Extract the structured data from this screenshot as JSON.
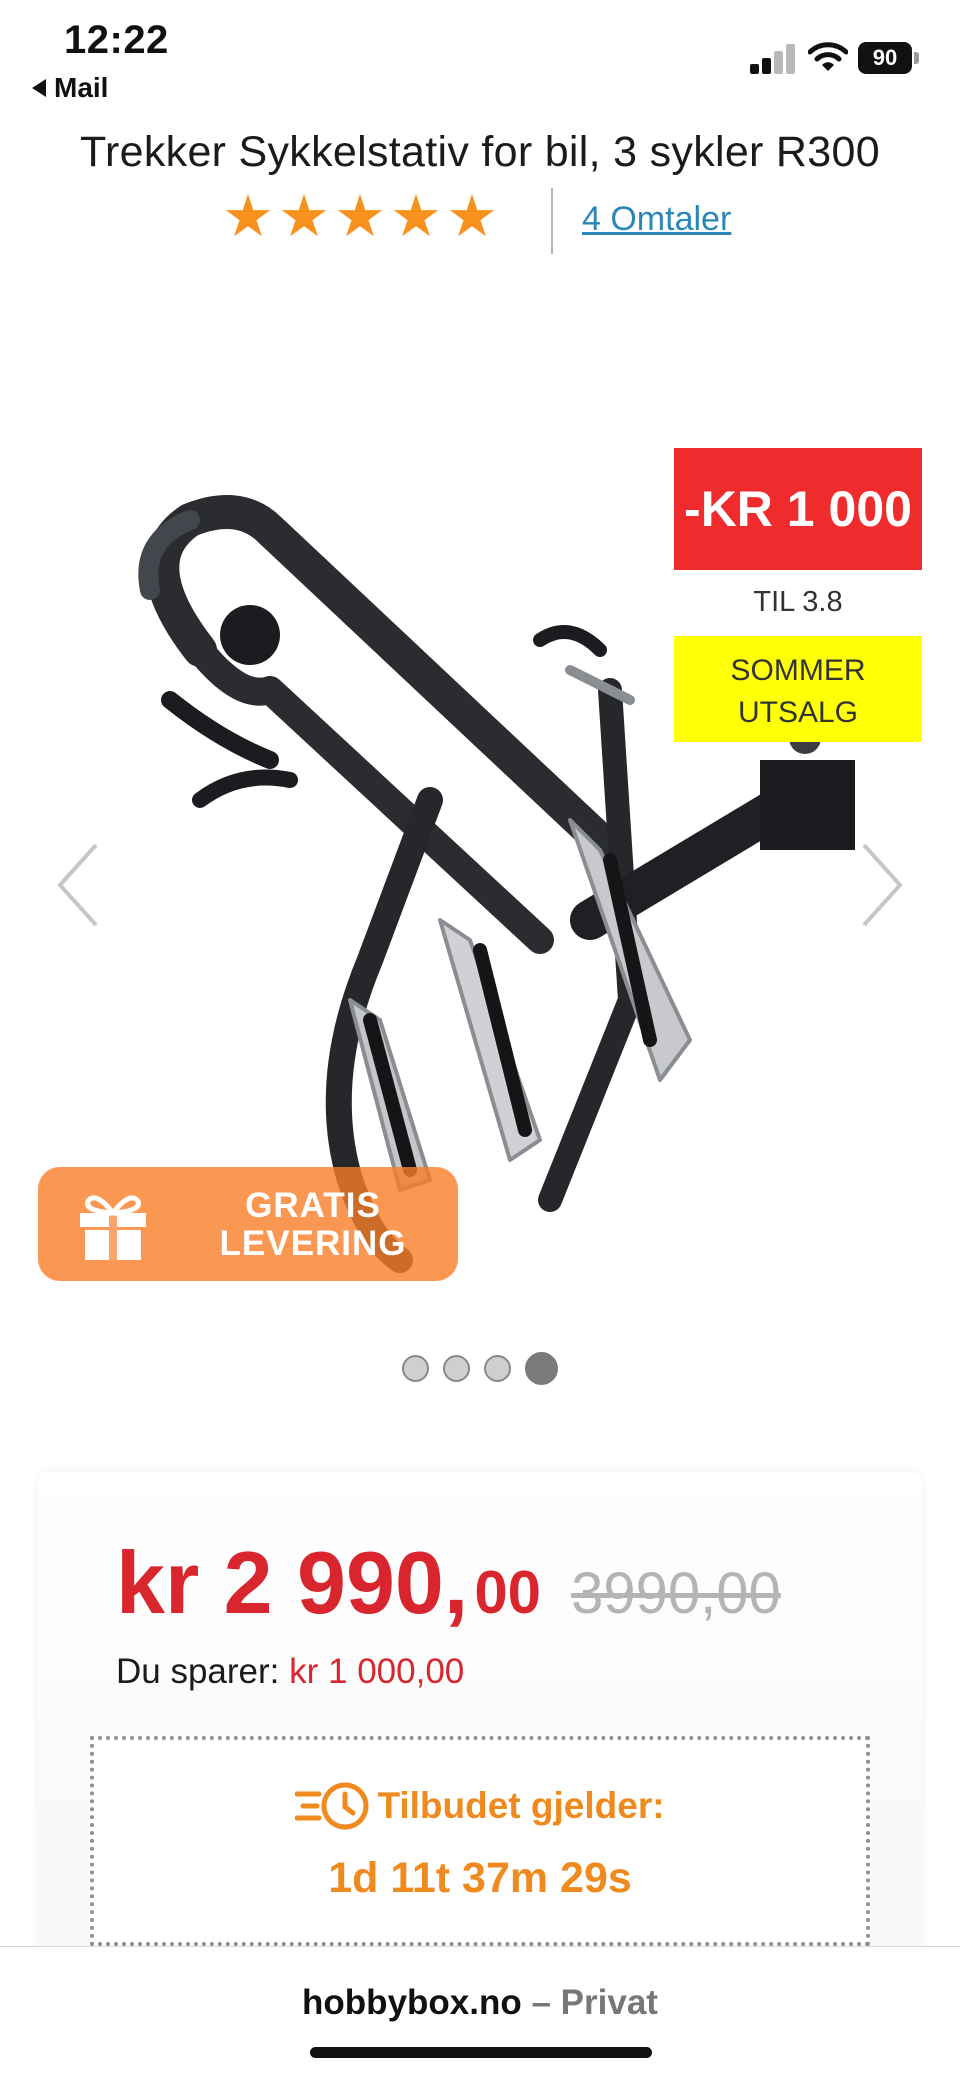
{
  "status_bar": {
    "time": "12:22",
    "back_app": "Mail",
    "battery": "90",
    "icons": [
      "signal-icon",
      "wifi-icon",
      "battery-icon"
    ]
  },
  "product": {
    "title": "Trekker Sykkelstativ for bil, 3 sykler R300",
    "rating_stars": 5,
    "reviews_link": "4 Omtaler"
  },
  "gallery": {
    "discount_badge": "-KR 1 000",
    "valid_until": "TIL 3.8",
    "sale_badge_line1": "SOMMER",
    "sale_badge_line2": "UTSALG",
    "free_delivery_line1": "GRATIS",
    "free_delivery_line2": "LEVERING",
    "slide_count": 4,
    "active_slide": 4,
    "image_description": "bike-rack-product-image"
  },
  "pricing": {
    "price_main": "kr 2 990,",
    "price_decimals": "00",
    "price_old": "3990,00",
    "savings_label": "Du sparer:",
    "savings_amount": "kr 1 000,00",
    "offer_label": "Tilbudet gjelder:",
    "countdown": "1d 11t 37m 29s"
  },
  "browser": {
    "site_domain": "hobbybox.no",
    "site_mode": " – Privat"
  },
  "colors": {
    "star": "#f7921e",
    "link": "#2b87b8",
    "price_red": "#d9262e",
    "discount_badge_bg": "#ef2b2d",
    "sale_badge_bg": "#ffff05",
    "delivery_badge_bg": "#f77d28",
    "offer_orange": "#ef8a1e"
  }
}
